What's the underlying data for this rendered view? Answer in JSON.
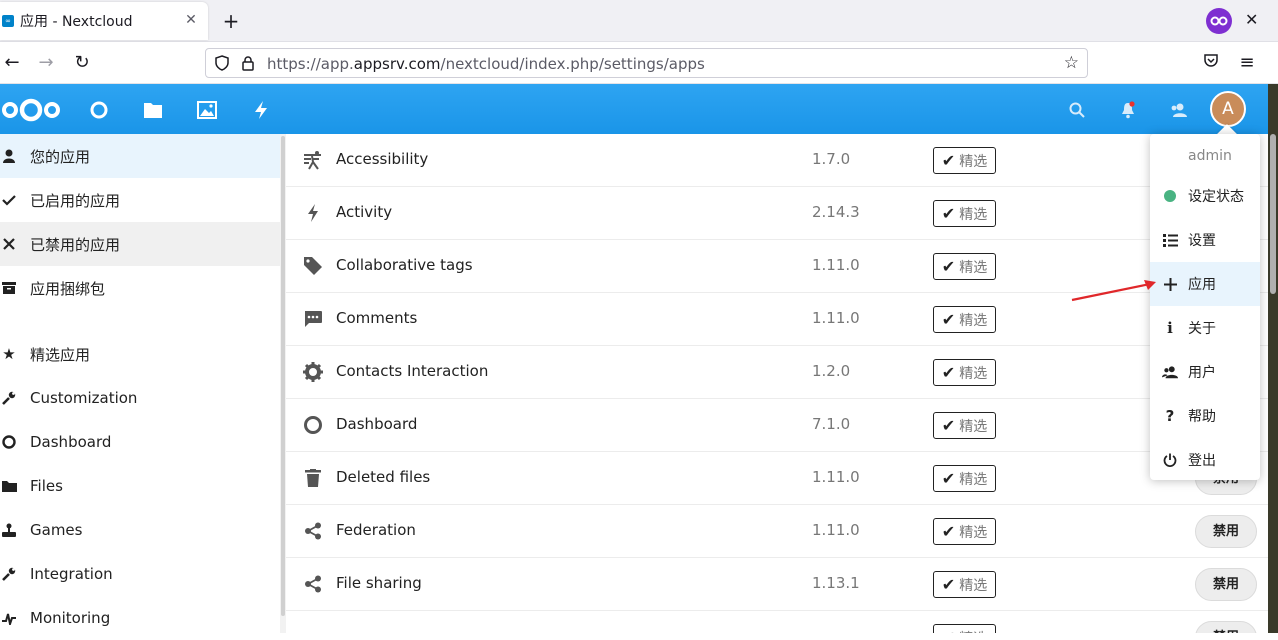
{
  "browser": {
    "tab_title": "应用 - Nextcloud",
    "tab_favicon": "nextcloud-icon",
    "new_tab_symbol": "+",
    "url_prefix": "https://app.",
    "url_domain": "appsrv.com",
    "url_path": "/nextcloud/index.php/settings/apps"
  },
  "header": {
    "avatar_letter": "A",
    "apps": [
      "dashboard-icon",
      "files-icon",
      "photos-icon",
      "activity-icon"
    ],
    "accent_color": "#1c9cf0"
  },
  "sidebar": {
    "items": [
      {
        "label": "您的应用",
        "icon": "user-icon"
      },
      {
        "label": "已启用的应用",
        "icon": "check-icon"
      },
      {
        "label": "已禁用的应用",
        "icon": "close-icon"
      },
      {
        "label": "应用捆绑包",
        "icon": "archive-icon"
      },
      {
        "label": "精选应用",
        "icon": "star-icon"
      },
      {
        "label": "Customization",
        "icon": "wrench-icon"
      },
      {
        "label": "Dashboard",
        "icon": "circle-icon"
      },
      {
        "label": "Files",
        "icon": "folder-icon"
      },
      {
        "label": "Games",
        "icon": "joystick-icon"
      },
      {
        "label": "Integration",
        "icon": "wrench-icon"
      },
      {
        "label": "Monitoring",
        "icon": "monitoring-icon"
      }
    ]
  },
  "apps": {
    "featured_label": "精选",
    "disable_label": "禁用",
    "rows": [
      {
        "name": "Accessibility",
        "version": "1.7.0"
      },
      {
        "name": "Activity",
        "version": "2.14.3"
      },
      {
        "name": "Collaborative tags",
        "version": "1.11.0"
      },
      {
        "name": "Comments",
        "version": "1.11.0"
      },
      {
        "name": "Contacts Interaction",
        "version": "1.2.0"
      },
      {
        "name": "Dashboard",
        "version": "7.1.0"
      },
      {
        "name": "Deleted files",
        "version": "1.11.0"
      },
      {
        "name": "Federation",
        "version": "1.11.0"
      },
      {
        "name": "File sharing",
        "version": "1.13.1"
      }
    ]
  },
  "menu": {
    "username": "admin",
    "items": [
      {
        "label": "设定状态",
        "icon": "status-dot-icon"
      },
      {
        "label": "设置",
        "icon": "settings-list-icon"
      },
      {
        "label": "应用",
        "icon": "plus-icon"
      },
      {
        "label": "关于",
        "icon": "info-icon"
      },
      {
        "label": "用户",
        "icon": "users-icon"
      },
      {
        "label": "帮助",
        "icon": "help-icon"
      },
      {
        "label": "登出",
        "icon": "power-icon"
      }
    ]
  }
}
